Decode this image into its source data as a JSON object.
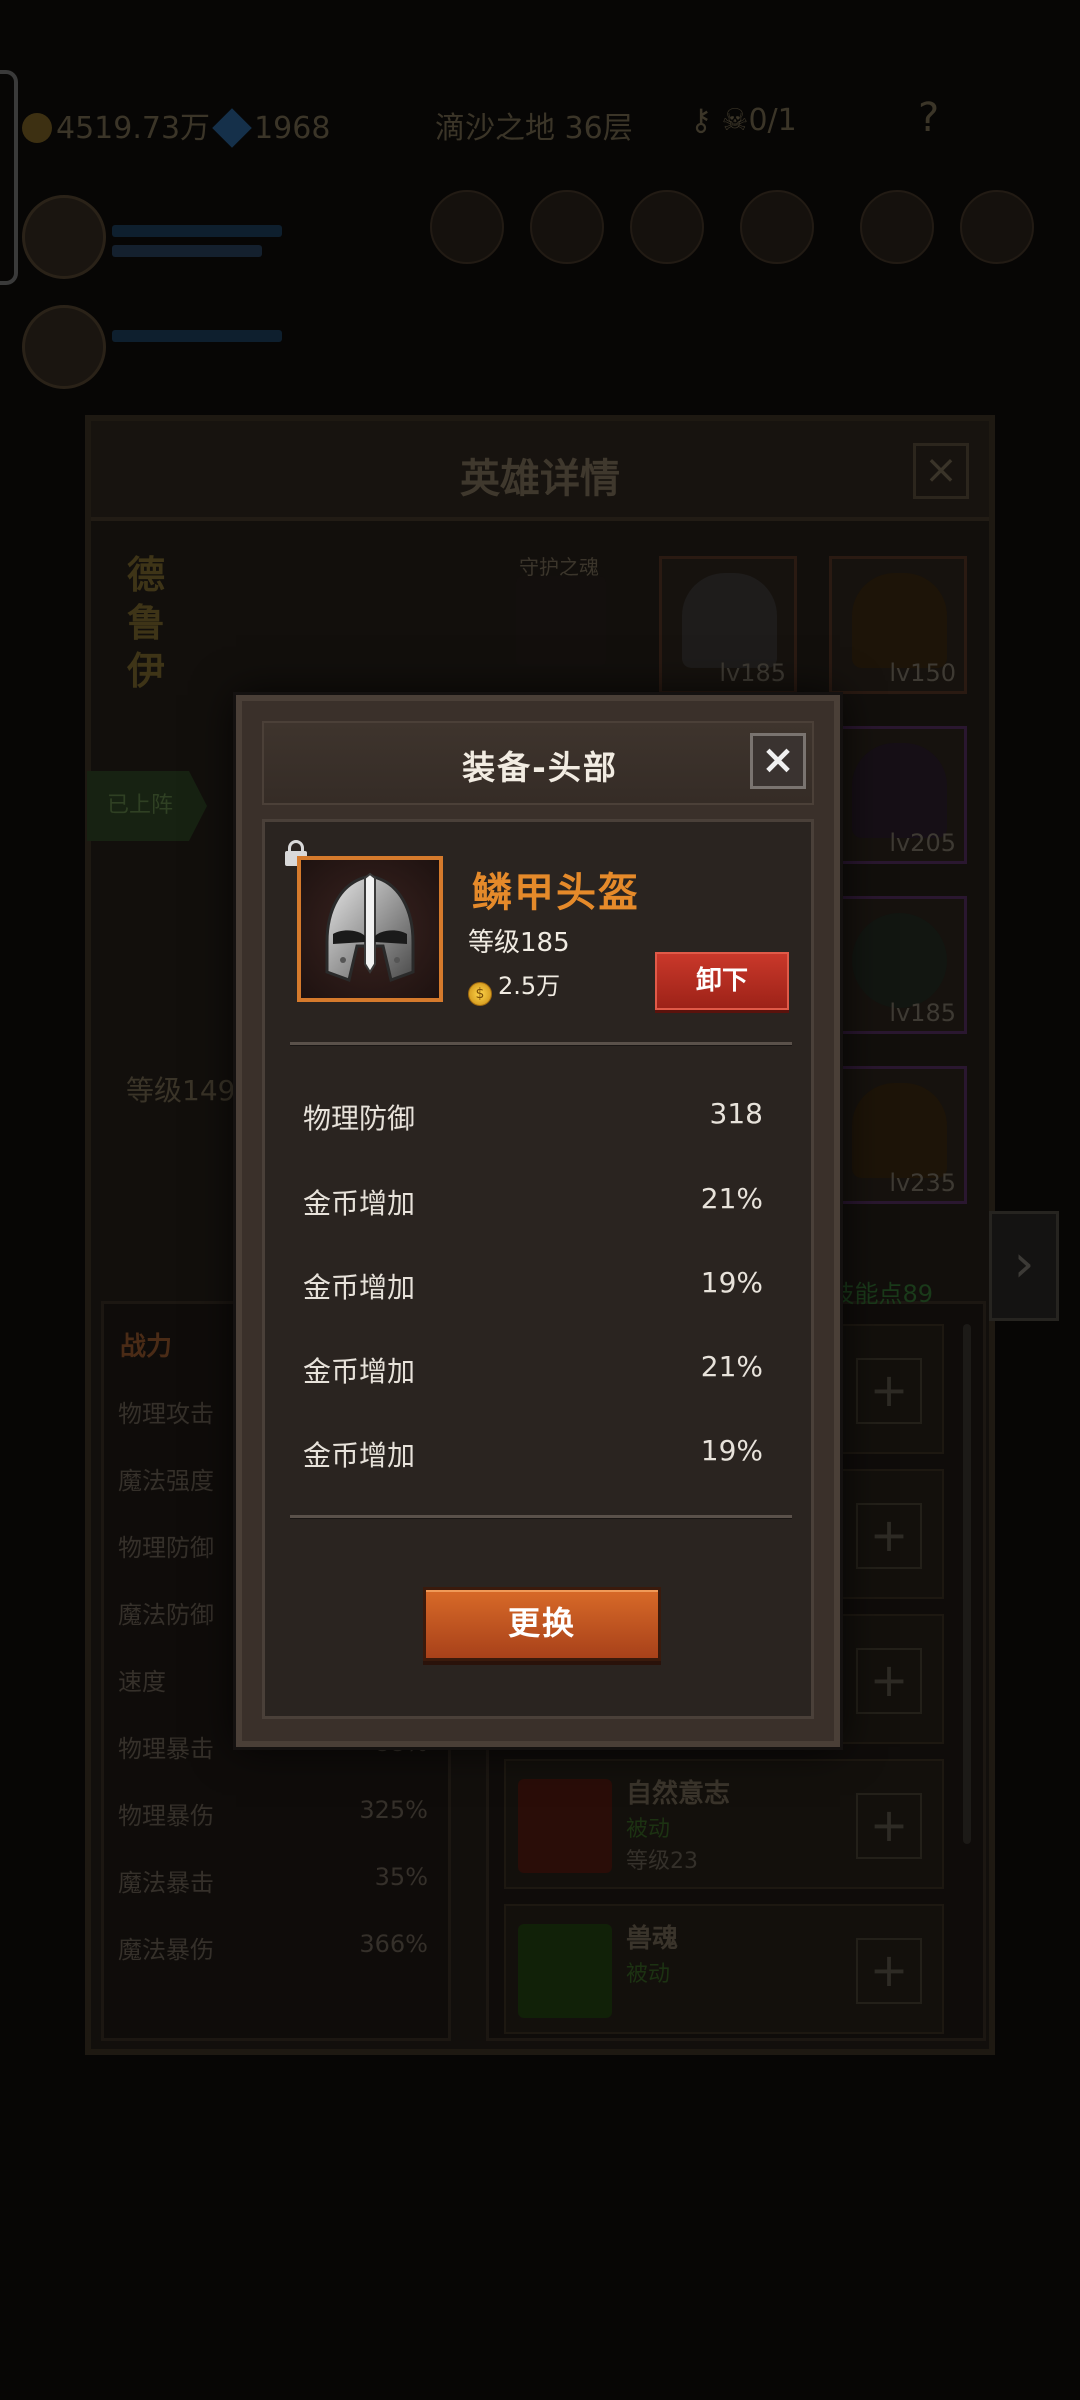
{
  "topbar": {
    "gold": "4519.73万",
    "gems": "1968",
    "stage": "滴沙之地 36层",
    "keys": "0/1",
    "help": "?"
  },
  "hero_panel": {
    "title": "英雄详情",
    "close": "×",
    "hero_name": "德鲁伊",
    "soul_label": "守护之魂",
    "deployed_tag": "已上阵",
    "level_text": "等级149",
    "skill_points": "技能点89",
    "equipment": [
      {
        "level": "lv185"
      },
      {
        "level": "lv150"
      },
      {
        "level": "lv205"
      },
      {
        "level": "lv185"
      },
      {
        "level": "lv235"
      }
    ],
    "stats_caption": "战力",
    "stats": [
      {
        "label": "物理攻击",
        "value": ""
      },
      {
        "label": "魔法强度",
        "value": ""
      },
      {
        "label": "物理防御",
        "value": ""
      },
      {
        "label": "魔法防御",
        "value": ""
      },
      {
        "label": "速度",
        "value": ""
      },
      {
        "label": "物理暴击",
        "value": "88%"
      },
      {
        "label": "物理暴伤",
        "value": "325%"
      },
      {
        "label": "魔法暴击",
        "value": "35%"
      },
      {
        "label": "魔法暴伤",
        "value": "366%"
      }
    ],
    "skills": [
      {
        "name": "自然意志",
        "type": "被动",
        "level": "等级23"
      },
      {
        "name": "兽魂",
        "type": "被动",
        "level": ""
      }
    ],
    "plus": "+",
    "next": "›"
  },
  "modal": {
    "title": "装备-头部",
    "close": "×",
    "item_name": "鳞甲头盔",
    "item_level": "等级185",
    "price": "2.5万",
    "coin_glyph": "$",
    "unequip_label": "卸下",
    "attributes": [
      {
        "label": "物理防御",
        "value": "318"
      },
      {
        "label": "金币增加",
        "value": "21%"
      },
      {
        "label": "金币增加",
        "value": "19%"
      },
      {
        "label": "金币增加",
        "value": "21%"
      },
      {
        "label": "金币增加",
        "value": "19%"
      }
    ],
    "replace_label": "更换"
  }
}
